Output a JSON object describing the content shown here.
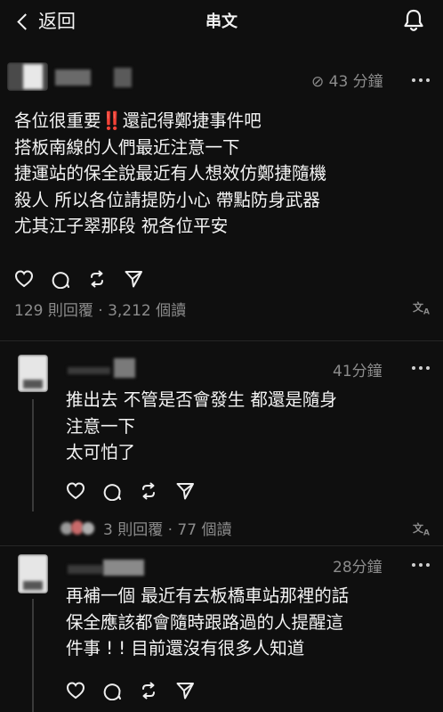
{
  "header": {
    "back_label": "返回",
    "title": "串文"
  },
  "main_post": {
    "time": "⊘ 43 分鐘",
    "lines": [
      "各位很重要‼️還記得鄭捷事件吧",
      "搭板南線的人們最近注意一下",
      "捷運站的保全說最近有人想效仿鄭捷隨機",
      "殺人 所以各位請提防小心 帶點防身武器",
      "尤其江子翠那段 祝各位平安"
    ],
    "stats": "129 則回覆 · 3,212 個讀",
    "translate_icon": "translate-icon"
  },
  "replies": [
    {
      "time": "41分鐘",
      "lines": [
        "推出去 不管是否會發生  都還是隨身",
        "注意一下",
        "太可怕了"
      ],
      "stats": "3 則回覆 · 77 個讀"
    },
    {
      "time": "28分鐘",
      "lines": [
        "再補一個 最近有去板橋車站那裡的話",
        "保全應該都會隨時跟路過的人提醒這",
        "件事 ! ! 目前還沒有很多人知道"
      ]
    }
  ],
  "icons": [
    "back-chevron-icon",
    "bell-icon",
    "more-icon",
    "heart-icon",
    "comment-icon",
    "repost-icon",
    "send-icon",
    "translate-icon"
  ]
}
